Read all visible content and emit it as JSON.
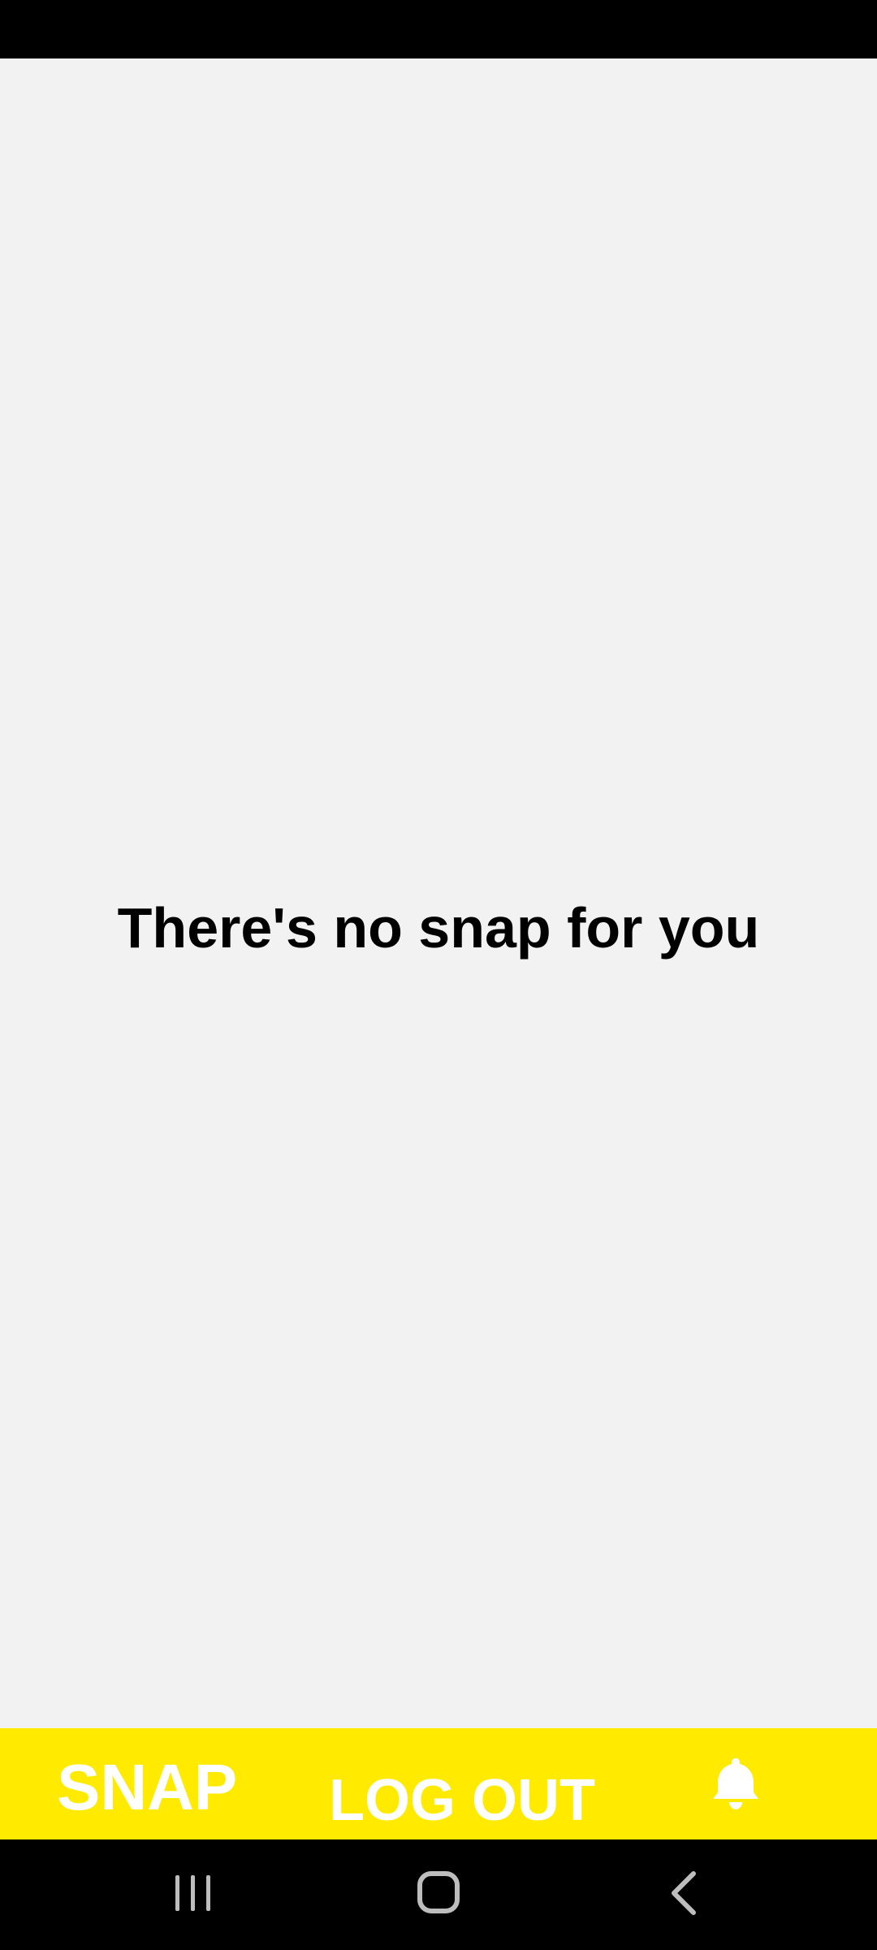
{
  "main": {
    "empty_message": "There's no snap for you"
  },
  "bottom_bar": {
    "snap_label": "SNAP",
    "logout_label": "LOG OUT",
    "notifications_icon": "bell-icon",
    "background_color": "#ffea00",
    "text_color": "#ffffff"
  },
  "system_nav": {
    "recents_icon": "recents-icon",
    "home_icon": "home-icon",
    "back_icon": "back-icon"
  }
}
